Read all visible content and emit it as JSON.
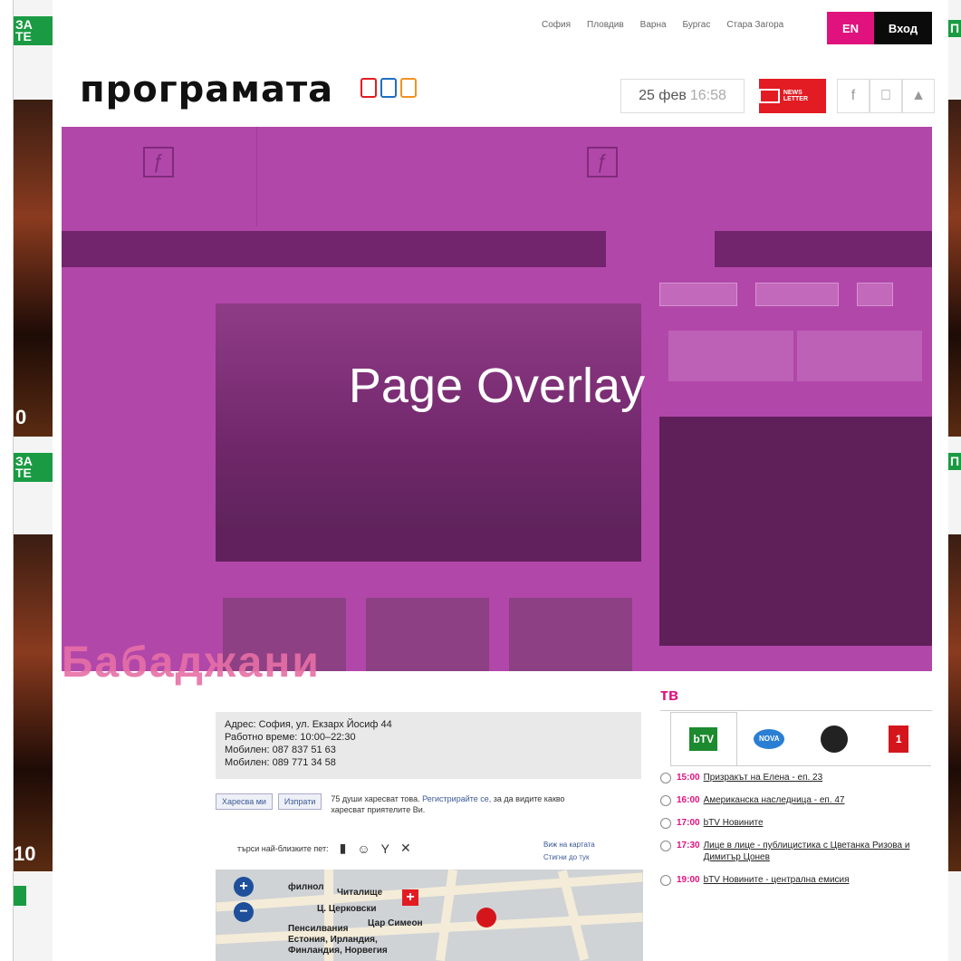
{
  "side_ads": {
    "left": [
      {
        "tag": "ЗА ТЕ",
        "number": "0"
      },
      {
        "tag": "ЗА ТЕ",
        "number": "10"
      }
    ],
    "right": [
      {
        "tag": "П"
      },
      {
        "tag": "П"
      }
    ]
  },
  "topbar": {
    "cities": [
      "София",
      "Пловдив",
      "Варна",
      "Бургас",
      "Стара Загора"
    ],
    "lang_button": "EN",
    "login_button": "Вход"
  },
  "header": {
    "logo": "програмата",
    "date": "25 фев",
    "time": "16:58",
    "newsletter": "NEWS LETTER"
  },
  "overlay": {
    "label": "Page Overlay"
  },
  "venue": {
    "name": "Бабаджани",
    "address": [
      "Адрес: София, ул. Екзарх Йосиф 44",
      "Работно време: 10:00–22:30",
      "Мобилен: 087 837 51 63",
      "Мобилен: 089 771 34 58"
    ]
  },
  "social": {
    "like_button": "Харесва ми",
    "send_button": "Изпрати",
    "text": "75 души харесват това.",
    "link": "Регистрирайте се,",
    "text2": "за да видите какво харесват приятелите Ви."
  },
  "nearby": {
    "label": "търси най-близките пет:"
  },
  "map_links": [
    "Виж на картата",
    "Стигни до тук"
  ],
  "map": {
    "labels": [
      "филнол",
      "Читалище",
      "Ц. Церковски",
      "Цар Симеон",
      "Пенсилвания",
      "Естония, Ирландия,",
      "Финландия, Норвегия"
    ]
  },
  "tv": {
    "title": "тв",
    "channels": [
      "bTV",
      "NOVA",
      "",
      "1"
    ],
    "schedule": [
      {
        "time": "15:00",
        "program": "Призракът на Елена - еп. 23"
      },
      {
        "time": "16:00",
        "program": "Американска наследница - еп. 47"
      },
      {
        "time": "17:00",
        "program": "bTV Новините"
      },
      {
        "time": "17:30",
        "program": "Лице в лице - публицистика с Цветанка Ризова и Димитър Цонев"
      },
      {
        "time": "19:00",
        "program": "bTV Новините - централна емисия"
      }
    ]
  },
  "colors": {
    "accent": "#e0127e",
    "overlay": "#b042a8",
    "green": "#1a9b43"
  }
}
